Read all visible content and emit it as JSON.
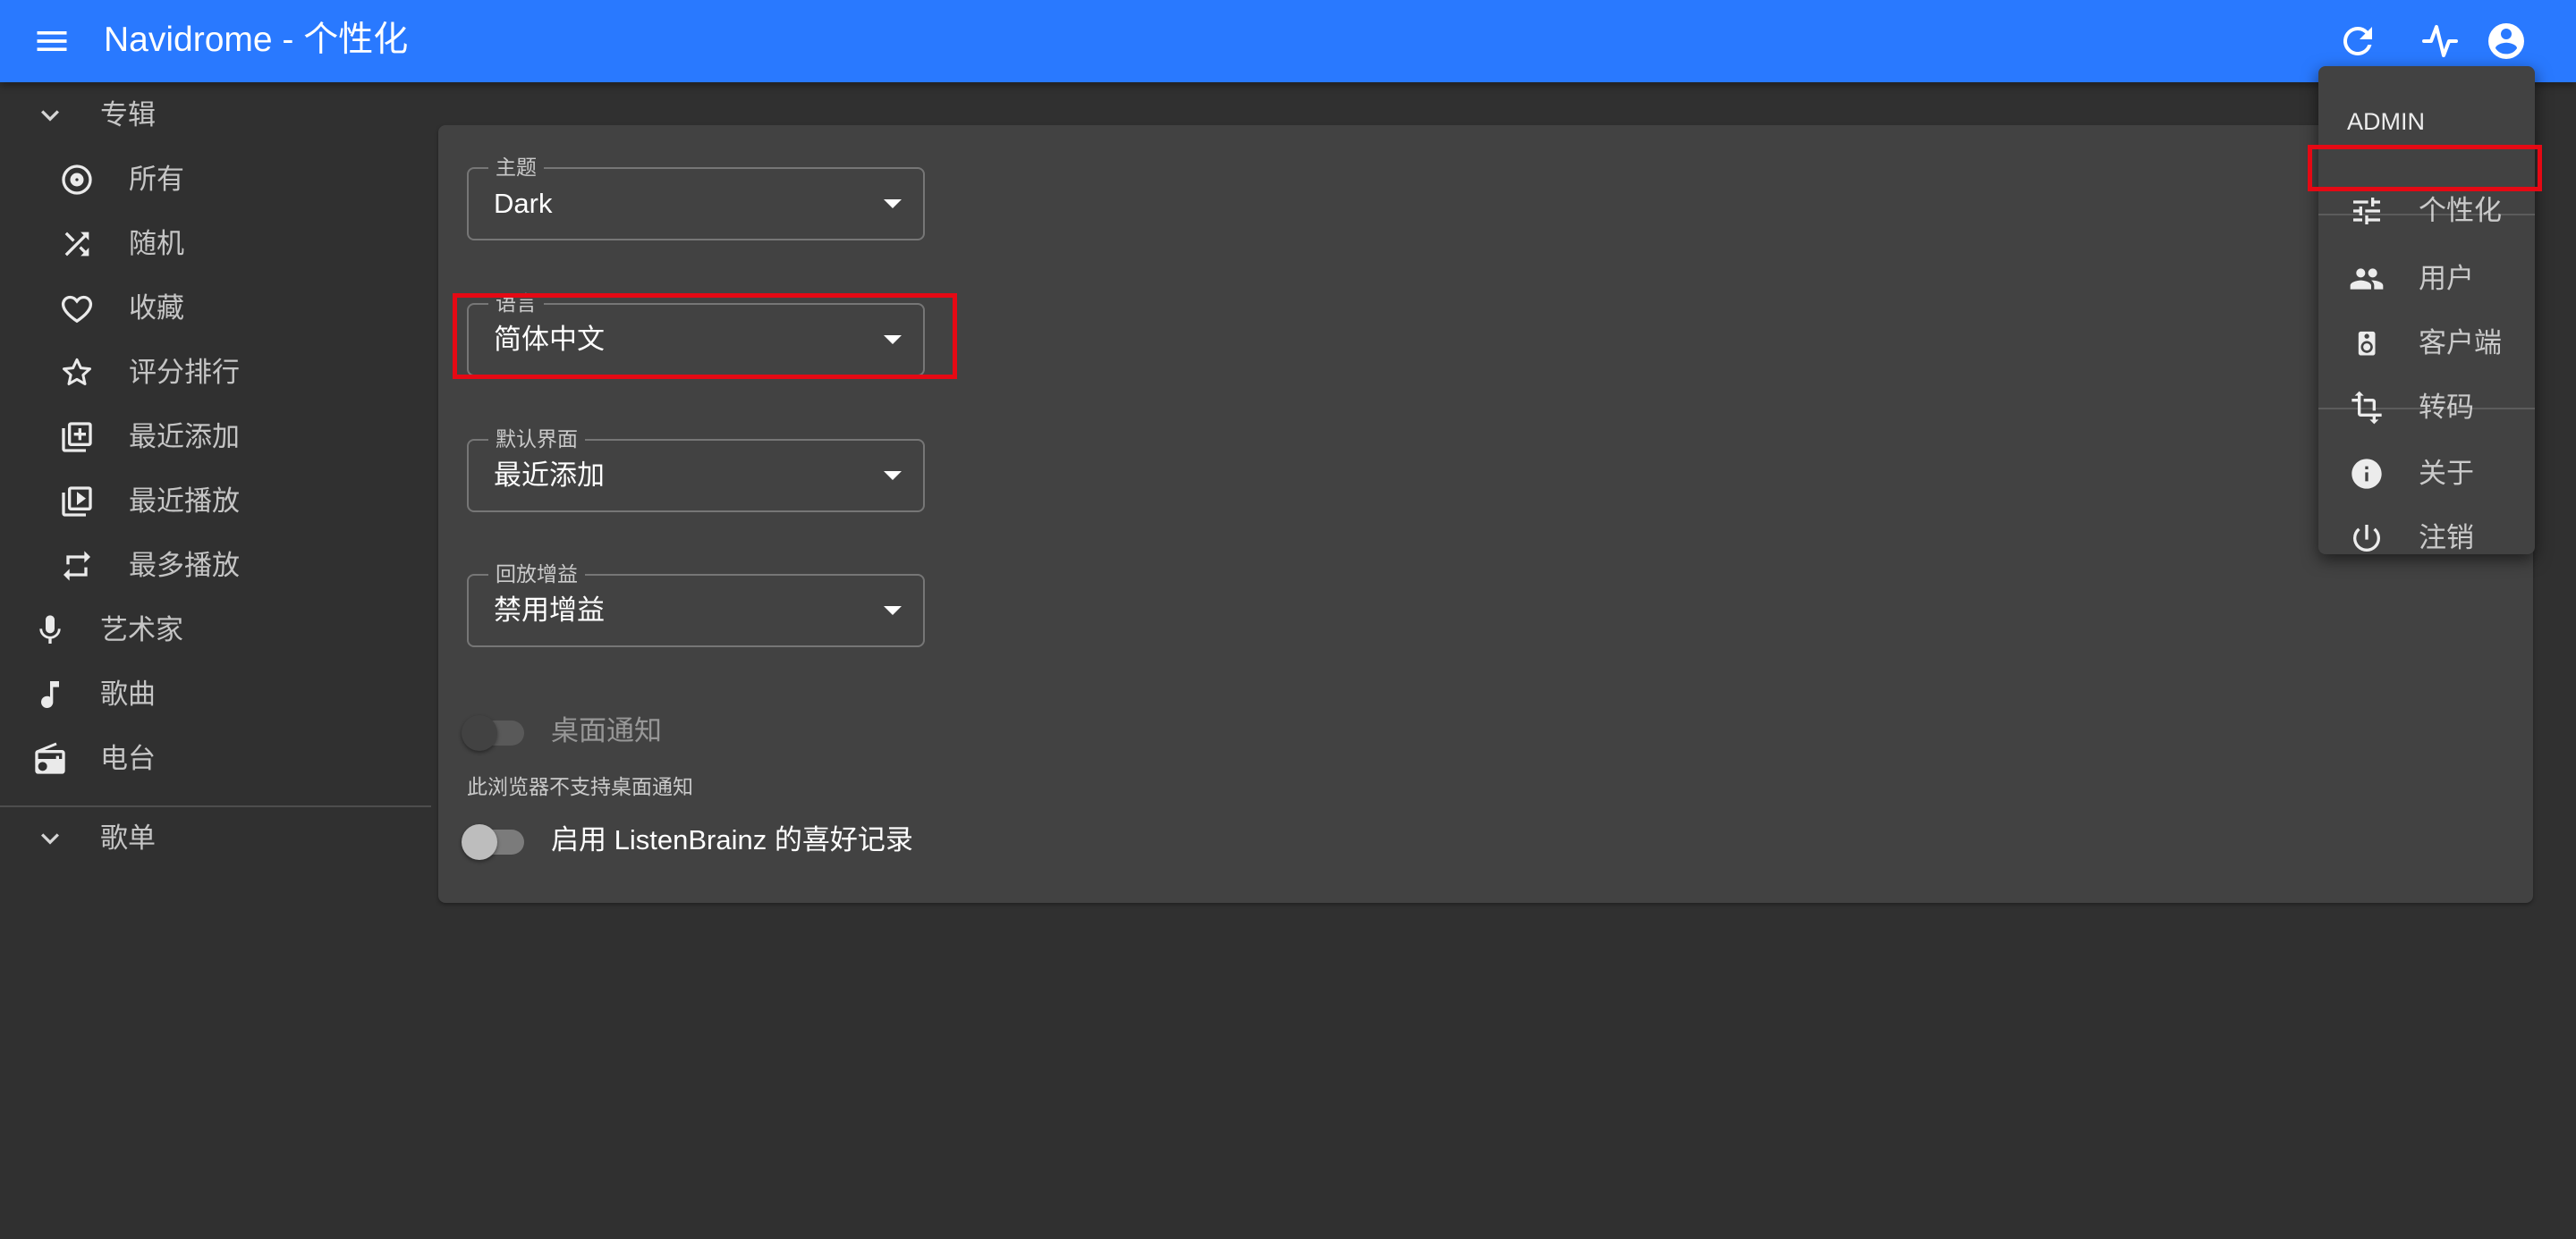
{
  "app_bar": {
    "title": "Navidrome - 个性化",
    "icons": [
      "menu-icon",
      "refresh-icon",
      "activity-icon",
      "account-circle-icon"
    ],
    "background": "#2979ff"
  },
  "sidebar": {
    "albums_group": "专辑",
    "album_items": [
      {
        "label": "所有",
        "icon": "album-icon"
      },
      {
        "label": "随机",
        "icon": "shuffle-icon"
      },
      {
        "label": "收藏",
        "icon": "heart-icon"
      },
      {
        "label": "评分排行",
        "icon": "star-icon"
      },
      {
        "label": "最近添加",
        "icon": "library-add-icon"
      },
      {
        "label": "最近播放",
        "icon": "video-library-icon"
      },
      {
        "label": "最多播放",
        "icon": "repeat-icon"
      }
    ],
    "artists": "艺术家",
    "songs": "歌曲",
    "radios": "电台",
    "playlists_group": "歌单"
  },
  "settings": {
    "theme": {
      "label": "主题",
      "value": "Dark"
    },
    "language": {
      "label": "语言",
      "value": "简体中文"
    },
    "default_view": {
      "label": "默认界面",
      "value": "最近添加"
    },
    "replay_gain": {
      "label": "回放增益",
      "value": "禁用增益"
    },
    "desktop_notifications": {
      "label": "桌面通知",
      "enabled": false,
      "disabled": true
    },
    "notifications_helper": "此浏览器不支持桌面通知",
    "listenbrainz": {
      "label": "启用 ListenBrainz 的喜好记录",
      "enabled": false
    }
  },
  "user_menu": {
    "header": "ADMIN",
    "items": [
      {
        "label": "个性化",
        "icon": "tune-icon"
      },
      {
        "label": "用户",
        "icon": "people-icon"
      },
      {
        "label": "客户端",
        "icon": "speaker-icon"
      },
      {
        "label": "转码",
        "icon": "transform-icon"
      },
      {
        "label": "关于",
        "icon": "info-icon"
      },
      {
        "label": "注销",
        "icon": "power-icon"
      }
    ]
  },
  "colors": {
    "highlight": "#e50914",
    "background": "#303030",
    "card": "#424242"
  }
}
